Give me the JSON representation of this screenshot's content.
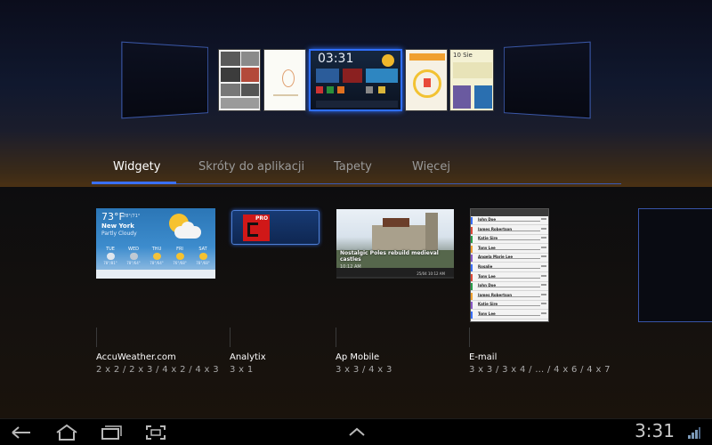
{
  "tabs": [
    {
      "label": "Widgety",
      "active": true
    },
    {
      "label": "Skróty do aplikacji",
      "active": false
    },
    {
      "label": "Tapety",
      "active": false
    },
    {
      "label": "Więcej",
      "active": false
    }
  ],
  "homescreen": {
    "active_clock": "03:31",
    "panel_label": "10 Sie"
  },
  "widgets": [
    {
      "name": "AccuWeather.com",
      "sizes": "2 x 2 / 2 x 3 / 4 x 2 / 4 x 3",
      "preview": {
        "temp": "73°F",
        "hilo": "78°/71°",
        "city": "New York",
        "condition": "Partly Cloudy",
        "forecast": [
          {
            "day": "TUE",
            "temp": "78°/81°"
          },
          {
            "day": "WED",
            "temp": "78°/64°"
          },
          {
            "day": "THU",
            "temp": "78°/64°"
          },
          {
            "day": "FRI",
            "temp": "76°/68°"
          },
          {
            "day": "SAT",
            "temp": "78°/68°"
          }
        ]
      }
    },
    {
      "name": "Analytix",
      "sizes": "3 x 1",
      "preview": {
        "logo_text": "PRO"
      }
    },
    {
      "name": "Ap Mobile",
      "sizes": "3 x 3 / 4 x 3",
      "preview": {
        "headline": "Nostalgic Poles rebuild medieval castles",
        "time": "10:12 AM",
        "date": "25/04 10:12 AM"
      }
    },
    {
      "name": "E-mail",
      "sizes": "3 x 3 / 3 x 4 / … / 4 x 6 / 4 x 7",
      "preview": {
        "senders": [
          "John Doe",
          "James Robertson",
          "Katie Sire",
          "Tony Lee",
          "Angela Marie Lee",
          "Rosalie",
          "Tony Lee",
          "John Doe",
          "James Robertson",
          "Katie Sire",
          "Tony Lee"
        ]
      }
    }
  ],
  "statusbar": {
    "time": "3:31"
  },
  "colors": {
    "accent": "#3a70ff",
    "tab_inactive": "#9a9a9a"
  },
  "icons": {
    "back": "back-arrow-icon",
    "home": "home-icon",
    "recent": "recent-apps-icon",
    "screenshot": "screenshot-icon",
    "up": "chevron-up-icon",
    "signal": "signal-icon"
  }
}
